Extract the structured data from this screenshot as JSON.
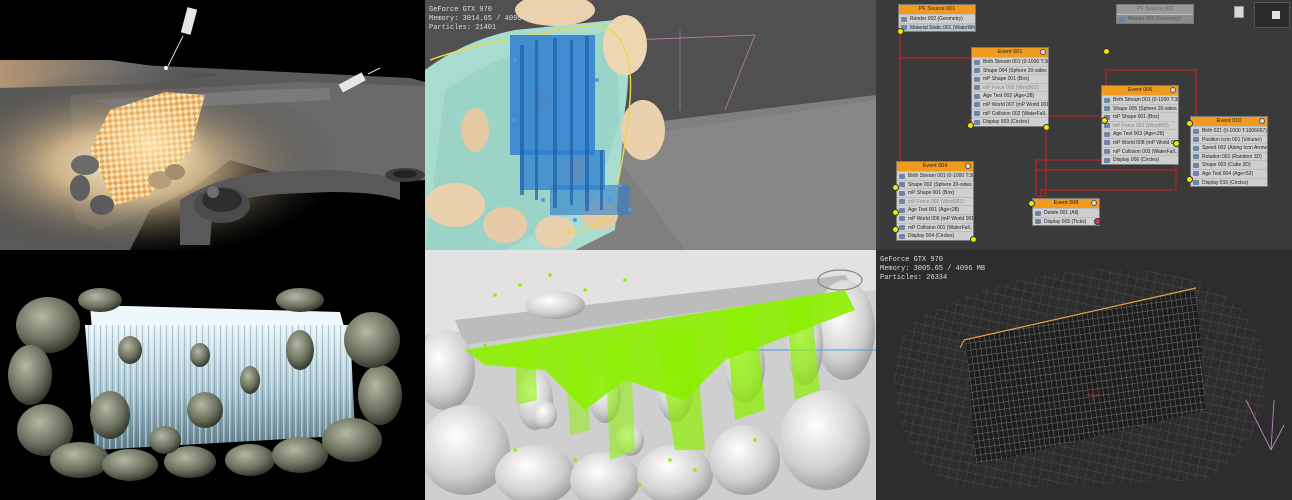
{
  "panel_top_middle": {
    "stats": [
      "GeForce GTX 970",
      "Memory: 3014.65 / 4096 MB",
      "Particles: 21401"
    ]
  },
  "panel_bottom_right": {
    "stats": [
      "GeForce GTX 970",
      "Memory: 3005.65 / 4096 MB",
      "Particles: 26334"
    ]
  },
  "particle_flow": {
    "nodes": [
      {
        "title": "PF Source 001",
        "rows": [
          "Render 002 (Geometry)",
          "Material Static 001 (WaterWhite)"
        ]
      },
      {
        "title": "PF Source 002",
        "rows": [
          "Render 003 (Geometry)"
        ]
      },
      {
        "title": "Event 001",
        "rows": [
          "Birth Stream 001 (0-1000 T:386...",
          "Shape 004 (Sphere 20-sides 3D)",
          "mP Shape 001 (Box)",
          "mP Force 003 (Wind002)",
          "Age Test 002 (Age<28)",
          "mP World 007 (mP World 001)",
          "mP Collision 002 (WaterFall...",
          "Display 003 (Circles)"
        ]
      },
      {
        "title": "Event 004",
        "rows": [
          "Birth Stream 001 (0-1000 T:386...",
          "Shape 002 (Sphere 20-sides 3D)",
          "mP Shape 001 (Box)",
          "mP Force 002 (Wind002)",
          "Age Test 001 (Age<28)",
          "mP World 006 (mP World 001)",
          "mP Collision 001 (WaterFall...",
          "Display 004 (Circles)"
        ]
      },
      {
        "title": "Event 006",
        "rows": [
          "Birth Stream 001 (0-1000 T:386...",
          "Shape 005 (Sphere 20-sides 3D)",
          "mP Shape 001 (Box)",
          "mP Force 003 (Wind003)",
          "Age Test 003 (Age<28)",
          "mP World 008 (mP World 001)",
          "mP Collision 003 (WaterFall...",
          "Display 006 (Circles)"
        ]
      },
      {
        "title": "Event 008",
        "rows": [
          "Delete 001 (All)",
          "Display 005 (Ticks)"
        ]
      },
      {
        "title": "Event 010",
        "rows": [
          "Birth 021 (0-1000 T:1006667)",
          "Position Icon 001 (Volume)",
          "Speed 002 (Along Icon Arrow)",
          "Rotation 001 (Random 3D)",
          "Shape 003 (Cube 3D)",
          "Age Test 004 (Age<52)",
          "Display 010 (Circles)"
        ]
      }
    ]
  },
  "colors": {
    "node_header": "#f09a1e",
    "node_body": "#cfcfcf",
    "wire": "#cc2222",
    "particles_blue": "#2f7fd0",
    "particles_green": "#8cf000",
    "selection": "#e8d84a"
  },
  "icons": [
    "spotlight-icon",
    "gear-icon",
    "event-icon"
  ]
}
